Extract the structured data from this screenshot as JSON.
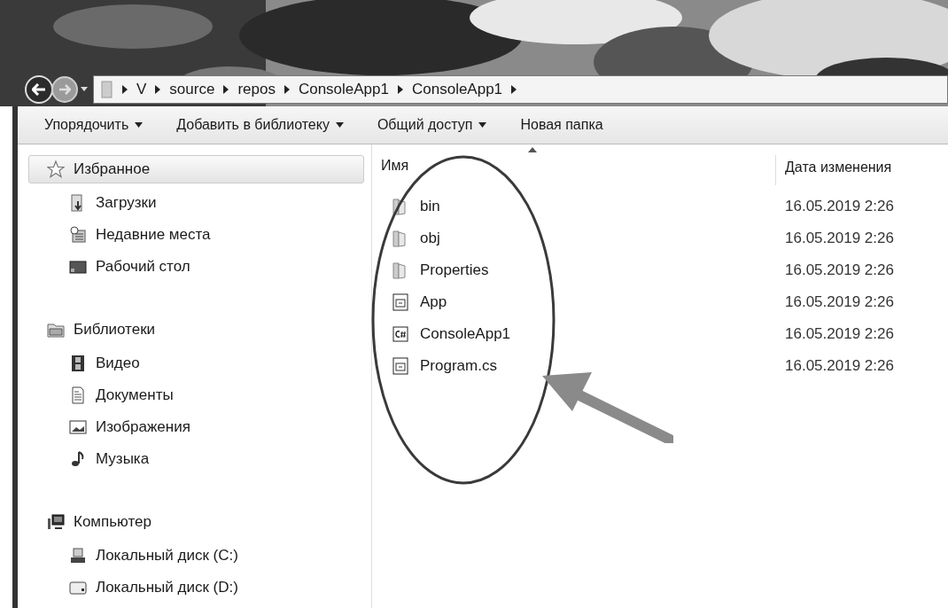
{
  "breadcrumbs": [
    "V",
    "source",
    "repos",
    "ConsoleApp1",
    "ConsoleApp1"
  ],
  "toolbar": [
    {
      "label": "Упорядочить",
      "dropdown": true
    },
    {
      "label": "Добавить в библиотеку",
      "dropdown": true
    },
    {
      "label": "Общий доступ",
      "dropdown": true
    },
    {
      "label": "Новая папка",
      "dropdown": false
    }
  ],
  "sidebar": {
    "groups": [
      {
        "label": "Избранное",
        "kind": "star",
        "selected": true,
        "children": [
          {
            "label": "Загрузки",
            "kind": "downloads"
          },
          {
            "label": "Недавние места",
            "kind": "recent"
          },
          {
            "label": "Рабочий стол",
            "kind": "desktop"
          }
        ]
      },
      {
        "label": "Библиотеки",
        "kind": "library",
        "selected": false,
        "children": [
          {
            "label": "Видео",
            "kind": "video"
          },
          {
            "label": "Документы",
            "kind": "documents"
          },
          {
            "label": "Изображения",
            "kind": "pictures"
          },
          {
            "label": "Музыка",
            "kind": "music"
          }
        ]
      },
      {
        "label": "Компьютер",
        "kind": "computer",
        "selected": false,
        "children": [
          {
            "label": "Локальный диск (C:)",
            "kind": "sysdrive"
          },
          {
            "label": "Локальный диск (D:)",
            "kind": "drive"
          }
        ]
      }
    ]
  },
  "table": {
    "columns": [
      "Имя",
      "Дата изменения"
    ],
    "rows": [
      {
        "name": "bin",
        "kind": "folder",
        "modified": "16.05.2019 2:26"
      },
      {
        "name": "obj",
        "kind": "folder",
        "modified": "16.05.2019 2:26"
      },
      {
        "name": "Properties",
        "kind": "folder",
        "modified": "16.05.2019 2:26"
      },
      {
        "name": "App",
        "kind": "config",
        "modified": "16.05.2019 2:26"
      },
      {
        "name": "ConsoleApp1",
        "kind": "csproj",
        "modified": "16.05.2019 2:26"
      },
      {
        "name": "Program.cs",
        "kind": "config",
        "modified": "16.05.2019 2:26"
      }
    ]
  }
}
